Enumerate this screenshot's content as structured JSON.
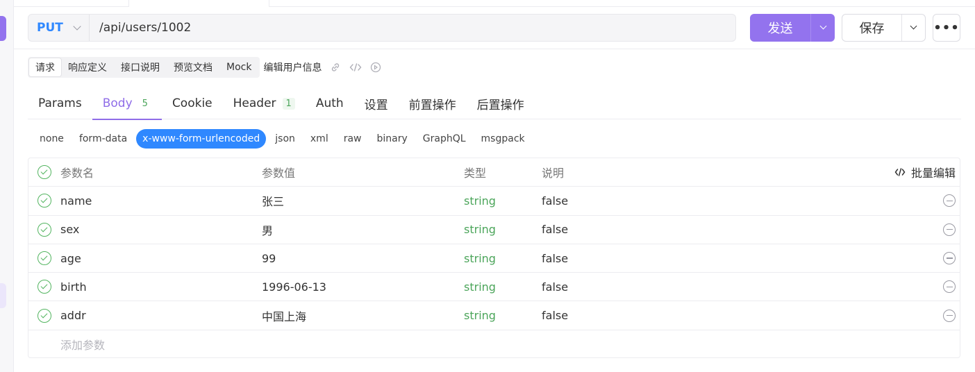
{
  "request": {
    "method": "PUT",
    "url": "/api/users/1002",
    "send_label": "发送",
    "save_label": "保存",
    "more_label": "•••"
  },
  "subtabs": {
    "items": [
      "请求",
      "响应定义",
      "接口说明",
      "预览文档",
      "Mock"
    ],
    "active": "请求",
    "extra": "编辑用户信息"
  },
  "tabs": [
    {
      "label": "Params",
      "count": ""
    },
    {
      "label": "Body",
      "count": "5",
      "active": true
    },
    {
      "label": "Cookie",
      "count": ""
    },
    {
      "label": "Header",
      "count": "1"
    },
    {
      "label": "Auth",
      "count": ""
    },
    {
      "label": "设置",
      "count": ""
    },
    {
      "label": "前置操作",
      "count": ""
    },
    {
      "label": "后置操作",
      "count": ""
    }
  ],
  "body_types": {
    "items": [
      "none",
      "form-data",
      "x-www-form-urlencoded",
      "json",
      "xml",
      "raw",
      "binary",
      "GraphQL",
      "msgpack"
    ],
    "active": "x-www-form-urlencoded"
  },
  "params": {
    "headers": {
      "name": "参数名",
      "value": "参数值",
      "type": "类型",
      "desc": "说明"
    },
    "bulk_edit_label": "批量编辑",
    "rows": [
      {
        "name": "name",
        "value": "张三",
        "type": "string",
        "desc": "false"
      },
      {
        "name": "sex",
        "value": "男",
        "type": "string",
        "desc": "false"
      },
      {
        "name": "age",
        "value": "99",
        "type": "string",
        "desc": "false"
      },
      {
        "name": "birth",
        "value": "1996-06-13",
        "type": "string",
        "desc": "false"
      },
      {
        "name": "addr",
        "value": "中国上海",
        "type": "string",
        "desc": "false"
      }
    ],
    "add_placeholder": "添加参数"
  },
  "colors": {
    "accent": "#9373ee",
    "method": "#2f88ff",
    "type_text": "#4ba55a"
  },
  "icons": {
    "link": "link-icon",
    "code": "code-icon",
    "run": "run-icon"
  }
}
